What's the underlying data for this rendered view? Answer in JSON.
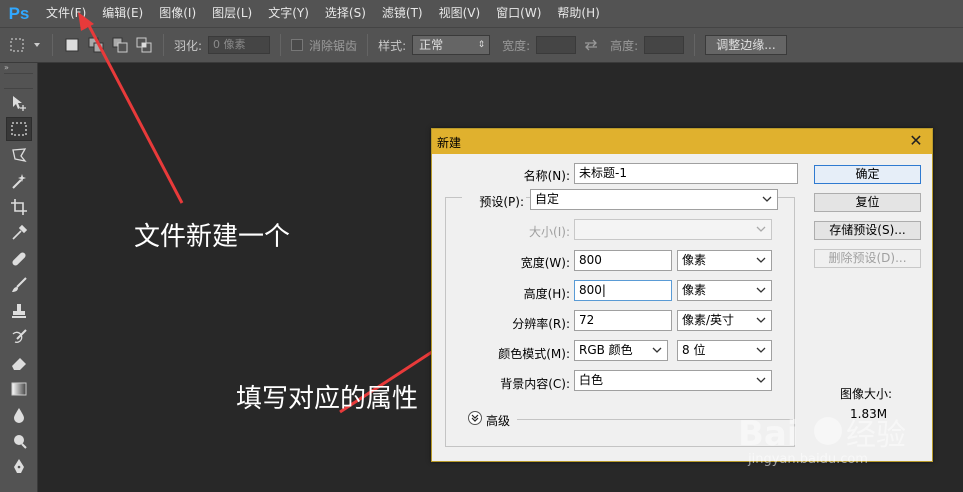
{
  "app": {
    "logo": "Ps"
  },
  "menu": [
    "文件(F)",
    "编辑(E)",
    "图像(I)",
    "图层(L)",
    "文字(Y)",
    "选择(S)",
    "滤镜(T)",
    "视图(V)",
    "窗口(W)",
    "帮助(H)"
  ],
  "options": {
    "feather_label": "羽化:",
    "feather_value": "0 像素",
    "antialias_label": "消除锯齿",
    "style_label": "样式:",
    "style_value": "正常",
    "width_label": "宽度:",
    "height_label": "高度:",
    "refine_edge_button": "调整边缘..."
  },
  "annotations": {
    "new_file": "文件新建一个",
    "fill_properties": "填写对应的属性"
  },
  "dialog": {
    "title": "新建",
    "name_label": "名称(N):",
    "name_value": "未标题-1",
    "preset_label": "预设(P):",
    "preset_value": "自定",
    "size_label": "大小(I):",
    "size_value": "",
    "width_label": "宽度(W):",
    "width_value": "800",
    "width_unit": "像素",
    "height_label": "高度(H):",
    "height_value": "800",
    "height_unit": "像素",
    "resolution_label": "分辨率(R):",
    "resolution_value": "72",
    "resolution_unit": "像素/英寸",
    "color_mode_label": "颜色模式(M):",
    "color_mode_value": "RGB 颜色",
    "bit_depth_value": "8 位",
    "background_label": "背景内容(C):",
    "background_value": "白色",
    "advanced_label": "高级",
    "ok_button": "确定",
    "reset_button": "复位",
    "save_preset_button": "存储预设(S)...",
    "delete_preset_button": "删除预设(D)...",
    "image_size_label": "图像大小:",
    "image_size_value": "1.83M"
  },
  "watermark": {
    "text": "jingyan.baidu.com"
  },
  "colors": {
    "accent_arrow": "#e83a3a",
    "dialog_title": "#e0b12e",
    "ps_blue": "#31a8ff"
  }
}
